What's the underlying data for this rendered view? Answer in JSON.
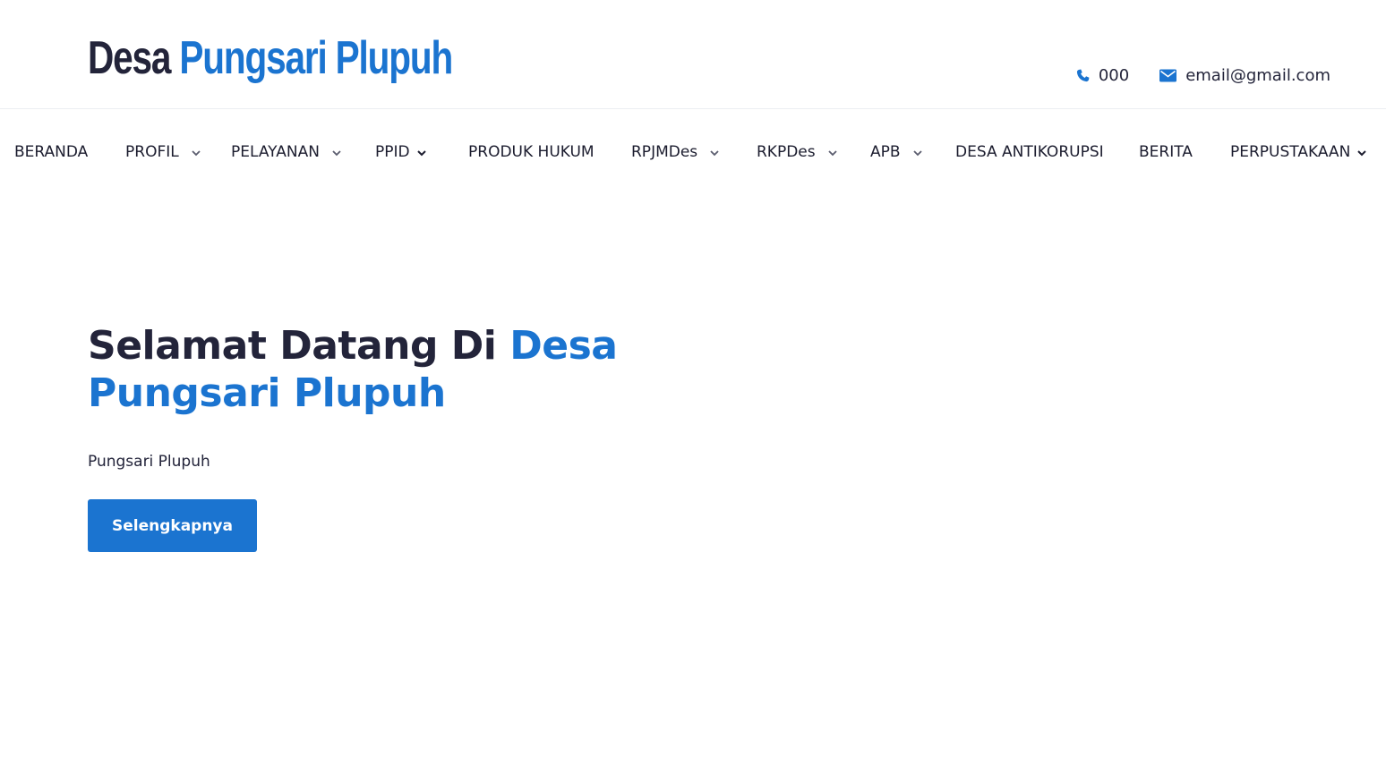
{
  "header": {
    "logo_part1": "Desa",
    "logo_part2": "Pungsari Plupuh",
    "phone_icon": "phone-icon",
    "phone": "000",
    "email_icon": "envelope-icon",
    "email": "email@gmail.com"
  },
  "nav": {
    "items": [
      {
        "label": "BERANDA",
        "dropdown": false
      },
      {
        "label": "PROFIL",
        "dropdown": true
      },
      {
        "label": "PELAYANAN",
        "dropdown": true
      },
      {
        "label": "PPID",
        "dropdown": true
      },
      {
        "label": "PRODUK HUKUM",
        "dropdown": false
      },
      {
        "label": "RPJMDes",
        "dropdown": true
      },
      {
        "label": "RKPDes",
        "dropdown": true
      },
      {
        "label": "APB",
        "dropdown": true
      },
      {
        "label": "DESA ANTIKORUPSI",
        "dropdown": false
      },
      {
        "label": "BERITA",
        "dropdown": false
      },
      {
        "label": "PERPUSTAKAAN",
        "dropdown": true
      }
    ]
  },
  "hero": {
    "title_dark": "Selamat Datang Di ",
    "title_blue_line1": "Desa",
    "title_blue_line2": "Pungsari Plupuh",
    "subtitle": "Pungsari Plupuh",
    "button_label": "Selengkapnya"
  },
  "colors": {
    "accent": "#1b74d0",
    "text_dark": "#23243a"
  }
}
